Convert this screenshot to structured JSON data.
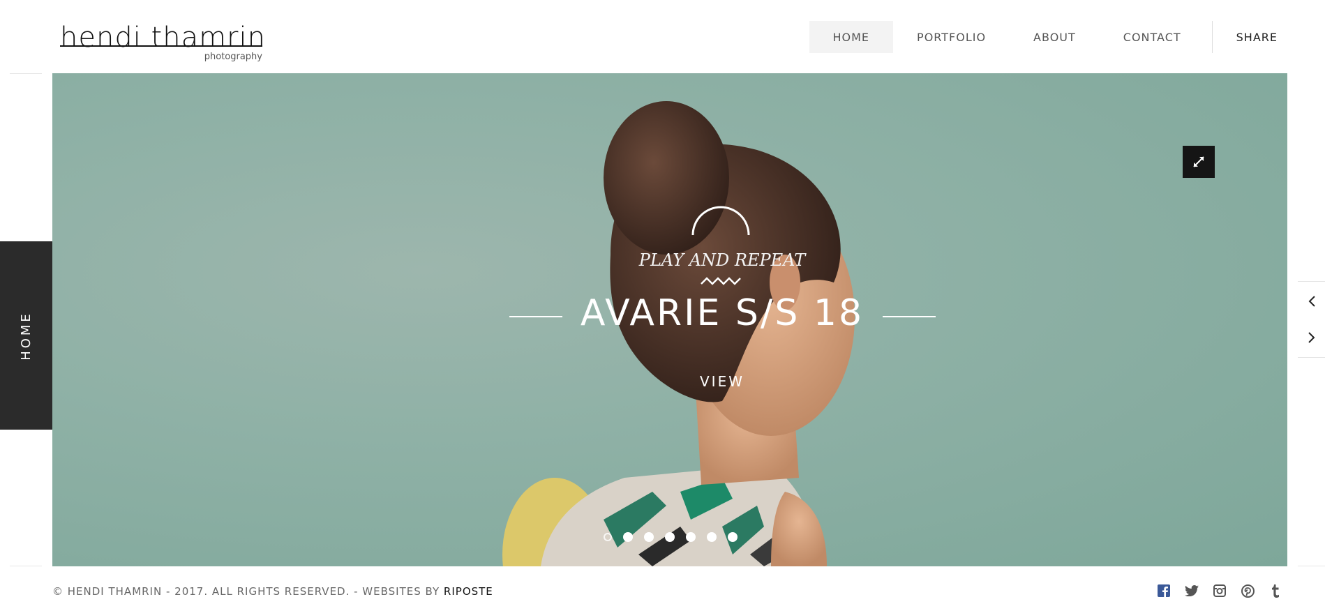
{
  "header": {
    "logo_name": "hendi thamrin",
    "logo_sub": "photography",
    "nav": [
      {
        "label": "HOME"
      },
      {
        "label": "PORTFOLIO"
      },
      {
        "label": "ABOUT"
      },
      {
        "label": "CONTACT"
      }
    ],
    "share_label": "SHARE"
  },
  "side_tab": {
    "label": "HOME"
  },
  "hero": {
    "subtitle": "PLAY AND REPEAT",
    "title": "AVARIE S/S 18",
    "view_label": "VIEW",
    "slide_count": 7,
    "active_slide": 1,
    "expand_icon": "expand-icon",
    "colors": {
      "background": "#8fb1a6",
      "overlay_text": "#ffffff"
    }
  },
  "arrows": {
    "prev_icon": "chevron-left-icon",
    "next_icon": "chevron-right-icon"
  },
  "footer": {
    "copyright_prefix": "© HENDI THAMRIN - 2017. ALL RIGHTS RESERVED. - WEBSITES BY ",
    "copyright_brand": "RIPOSTE",
    "socials": [
      "facebook-icon",
      "twitter-icon",
      "instagram-icon",
      "pinterest-icon",
      "tumblr-icon"
    ]
  },
  "colors": {
    "side_tab_bg": "#2b2b2b",
    "nav_active_bg": "#f3f3f3",
    "expand_btn_bg": "#151515",
    "facebook": "#3b5998"
  }
}
